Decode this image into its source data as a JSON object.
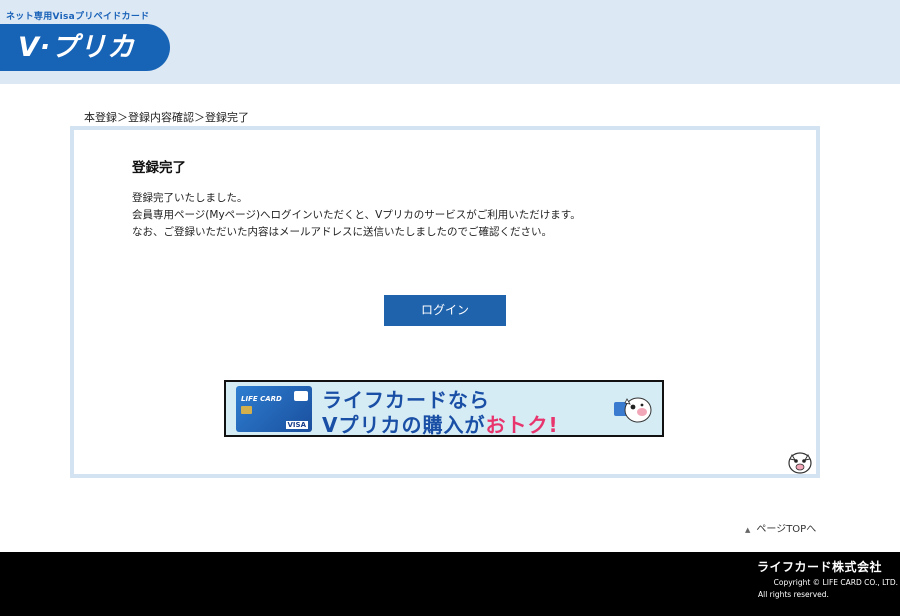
{
  "header": {
    "tagline": "ネット専用Visaプリペイドカード",
    "logo_text": "V·プリカ"
  },
  "breadcrumb": "本登録＞登録内容確認＞登録完了",
  "main": {
    "title": "登録完了",
    "messages": [
      "登録完了いたしました。",
      "会員専用ページ(Myページ)へログインいただくと、Vプリカのサービスがご利用いただけます。",
      "なお、ご登録いただいた内容はメールアドレスに送信いたしましたのでご確認ください。"
    ],
    "login_button": "ログイン"
  },
  "banner": {
    "line1": "ライフカードなら",
    "line2_prefix": "Vプリカの購入が",
    "line2_accent": "おトク!",
    "card_brand": "LIFE CARD",
    "card_network": "VISA"
  },
  "page_top": {
    "arrow": "▲",
    "label": "ページTOPへ"
  },
  "footer": {
    "company": "ライフカード株式会社",
    "copyright": "Copyright © LIFE CARD CO., LTD.",
    "rights": "All rights reserved."
  },
  "colors": {
    "header_bg": "#dce9f5",
    "brand_blue": "#1763b6",
    "button_blue": "#1f63ad",
    "panel_border": "#d3e3f1",
    "accent_pink": "#e8356d",
    "footer_bg": "#000000"
  }
}
